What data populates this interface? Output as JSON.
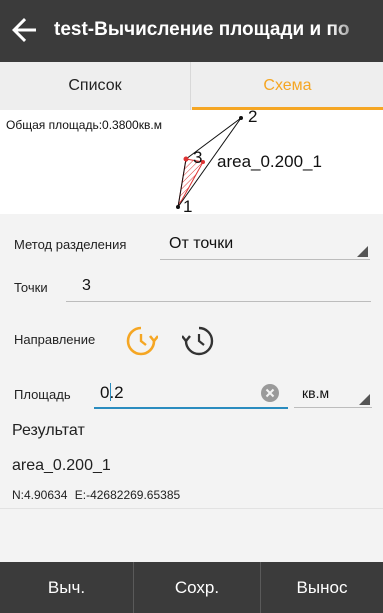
{
  "header": {
    "title": "test-Вычисление площади и по"
  },
  "tabs": [
    {
      "label": "Список",
      "active": false
    },
    {
      "label": "Схема",
      "active": true
    }
  ],
  "map": {
    "total_area": "Общая площадь:0.3800кв.м",
    "point_labels": [
      "2",
      "3",
      "1"
    ],
    "result_label": "area_0.200_1"
  },
  "form": {
    "method_label": "Метод разделения",
    "method_value": "От точки",
    "points_label": "Точки",
    "points_value": "3",
    "direction_label": "Направление",
    "area_label": "Площадь",
    "area_value": "0.2",
    "unit_value": "кв.м"
  },
  "result": {
    "title": "Результат",
    "name": "area_0.200_1",
    "n": "N:4.90634",
    "e": "E:-42682269.65385"
  },
  "footer": {
    "calc": "Выч.",
    "save": "Сохр.",
    "stakeout": "Вынос"
  },
  "colors": {
    "bar": "#3b3b3b",
    "accent": "#f5a623",
    "input_line": "#2a8cbf"
  }
}
